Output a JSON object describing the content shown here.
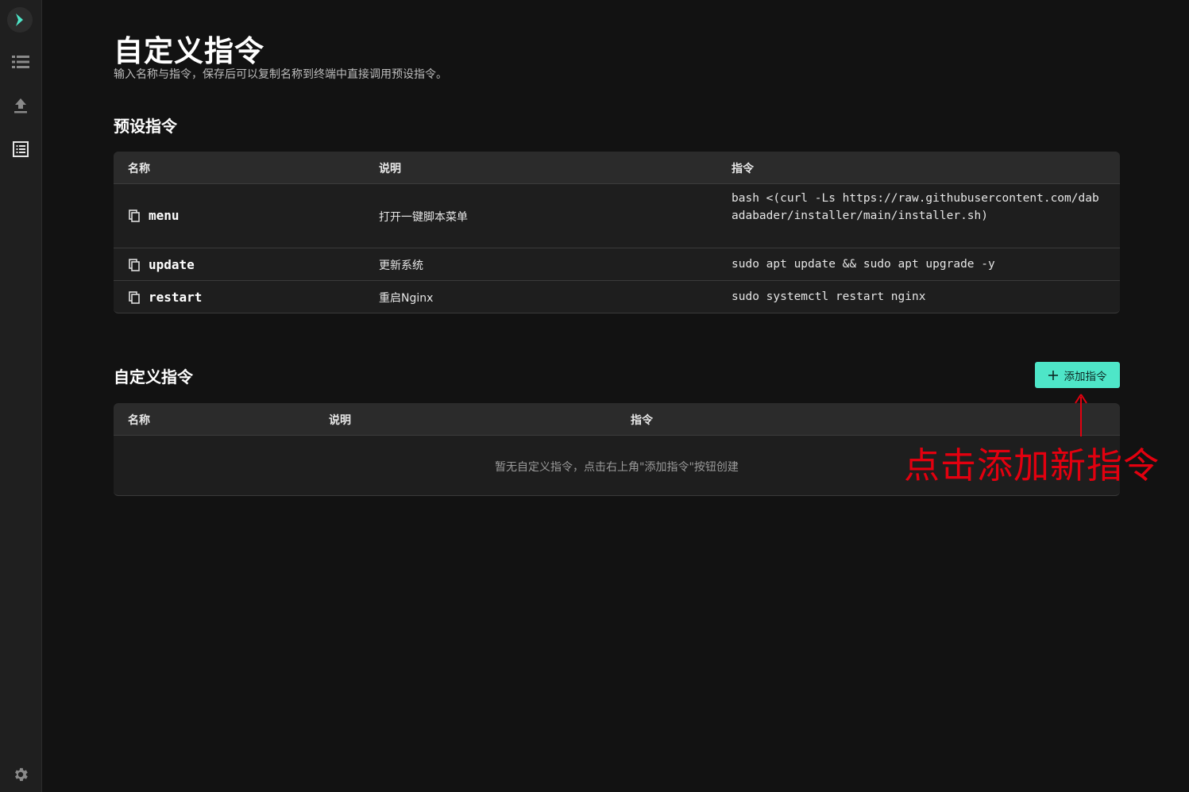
{
  "sidebar": {
    "items": [
      {
        "name": "logo",
        "icon": "chevron-right-icon"
      },
      {
        "name": "list",
        "icon": "list-icon"
      },
      {
        "name": "upload",
        "icon": "upload-icon"
      },
      {
        "name": "commands",
        "icon": "command-list-icon",
        "active": true
      }
    ],
    "settings_icon": "gear-icon"
  },
  "page": {
    "title": "自定义指令",
    "subtitle": "输入名称与指令，保存后可以复制名称到终端中直接调用预设指令。"
  },
  "preset": {
    "section_title": "预设指令",
    "columns": [
      "名称",
      "说明",
      "指令"
    ],
    "rows": [
      {
        "name": "menu",
        "desc": "打开一键脚本菜单",
        "command": "bash <(curl -Ls https://raw.githubusercontent.com/dabadabader/installer/main/installer.sh)"
      },
      {
        "name": "update",
        "desc": "更新系统",
        "command": "sudo apt update && sudo apt upgrade -y"
      },
      {
        "name": "restart",
        "desc": "重启Nginx",
        "command": "sudo systemctl restart nginx"
      }
    ]
  },
  "custom": {
    "section_title": "自定义指令",
    "add_button_label": "添加指令",
    "columns": [
      "名称",
      "说明",
      "指令"
    ],
    "empty_text": "暂无自定义指令，点击右上角\"添加指令\"按钮创建"
  },
  "annotation": {
    "text": "点击添加新指令",
    "color": "#e3000f"
  },
  "colors": {
    "accent": "#4ee6c8",
    "background": "#121212",
    "sidebar": "#1f1f1f"
  }
}
